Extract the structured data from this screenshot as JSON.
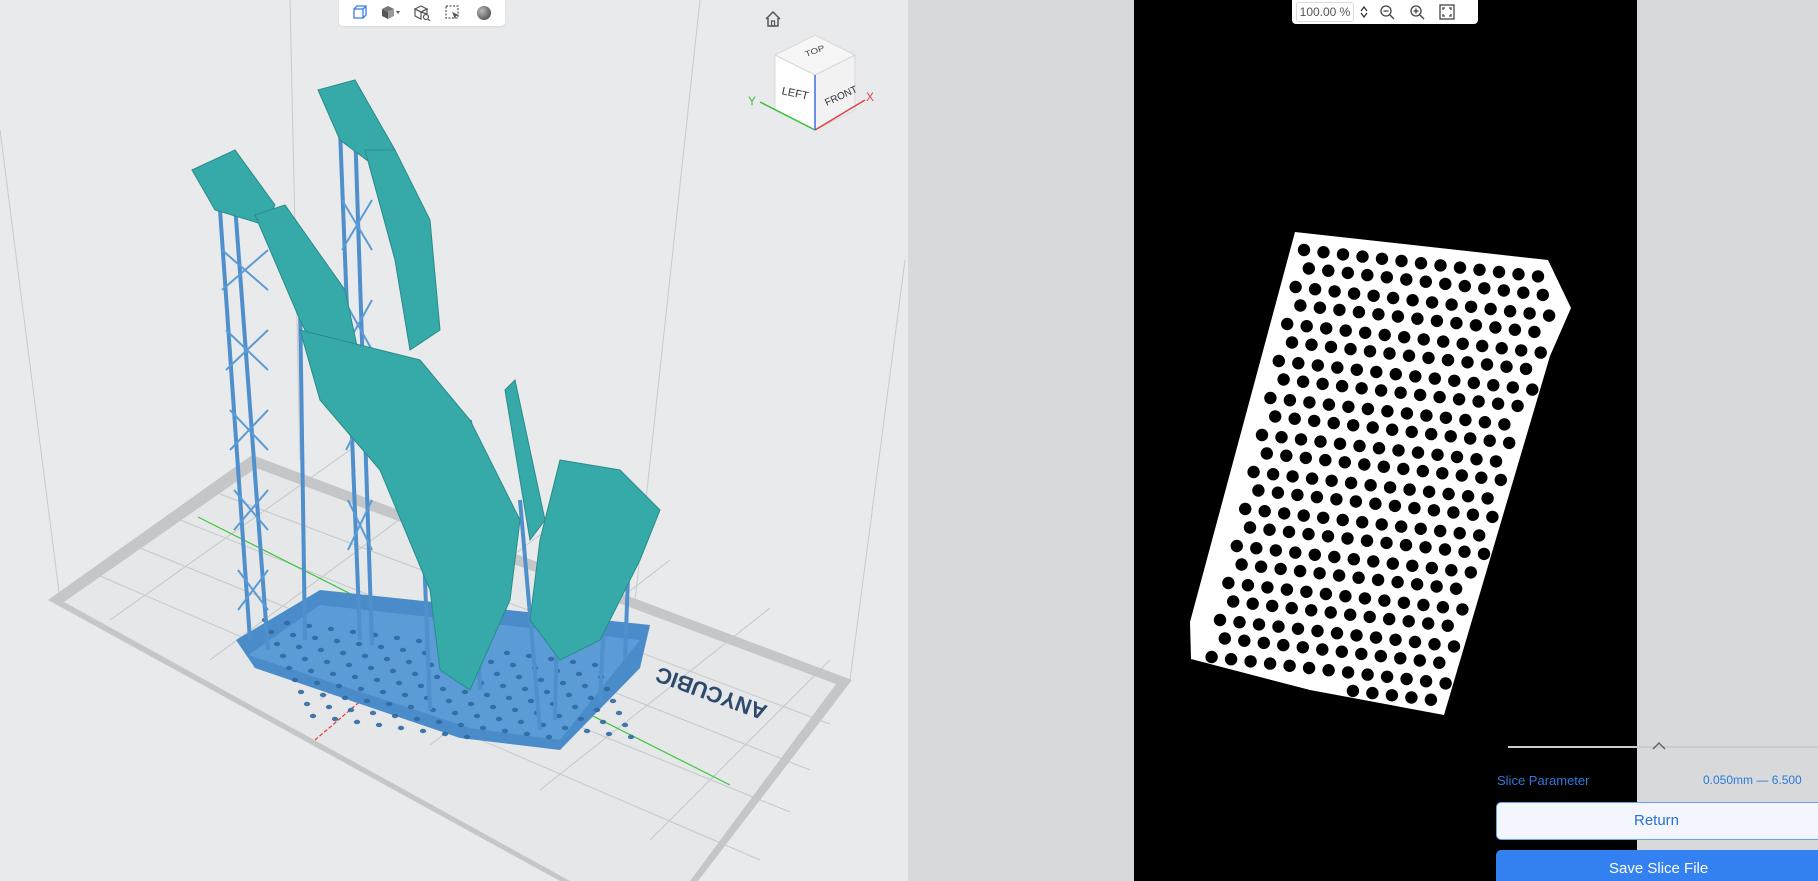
{
  "viewport": {
    "toolbar": {
      "items": [
        {
          "name": "perspective-view-icon"
        },
        {
          "name": "display-mode-icon"
        },
        {
          "name": "view-box-icon"
        },
        {
          "name": "select-icon"
        },
        {
          "name": "material-sphere-icon"
        }
      ]
    },
    "home_icon": "home-icon",
    "view_cube": {
      "top": "TOP",
      "left": "LEFT",
      "front": "FRONT",
      "axis_x": "X",
      "axis_y": "Y"
    },
    "plate_brand": "ANYCUBIC",
    "colors": {
      "model": "#35aaa8",
      "supports": "#4a8bc9",
      "background": "#e9eaec",
      "grid": "#c7c9cc"
    }
  },
  "preview": {
    "zoom": {
      "value": "100.00 %"
    },
    "colors": {
      "background": "#000000",
      "layer": "#ffffff"
    }
  },
  "panel": {
    "slice_parameter_label": "Slice Parameter",
    "slice_parameter_value": "0.050mm — 6.500",
    "return_label": "Return",
    "save_label": "Save Slice File",
    "accent": "#3381f0"
  }
}
